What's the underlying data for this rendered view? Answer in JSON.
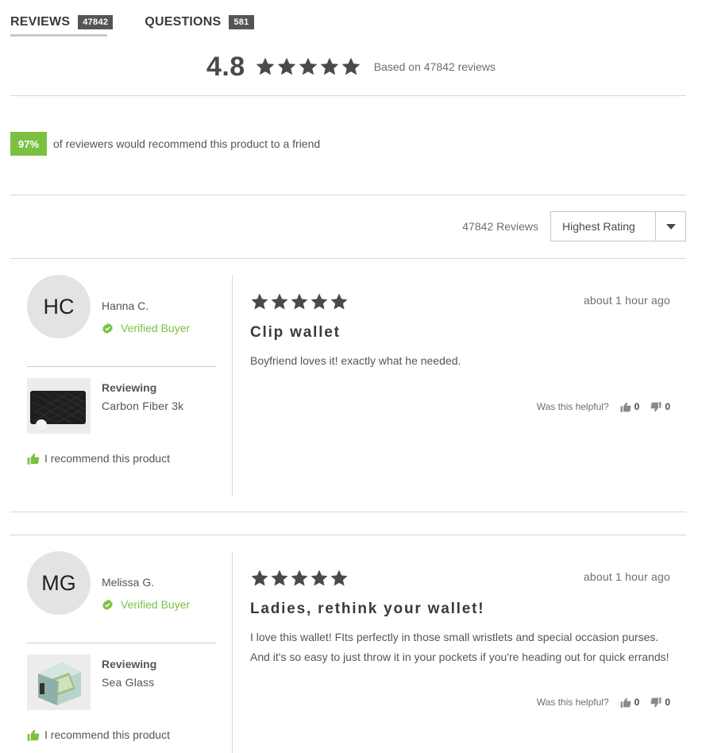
{
  "tabs": [
    {
      "label": "REVIEWS",
      "count": "47842"
    },
    {
      "label": "QUESTIONS",
      "count": "581"
    }
  ],
  "summary": {
    "average": "4.8",
    "stars": 5,
    "based_on": "Based on 47842 reviews"
  },
  "recommend": {
    "percent": "97%",
    "text": "of reviewers would recommend this product to a friend"
  },
  "sort": {
    "count_label": "47842 Reviews",
    "selected": "Highest Rating"
  },
  "colors": {
    "accent_green": "#7ac142",
    "star": "#4a4a4a",
    "badge_dark": "#555555"
  },
  "reviews": [
    {
      "initials": "HC",
      "name": "Hanna C.",
      "verified": "Verified Buyer",
      "reviewing_label": "Reviewing",
      "product": "Carbon Fiber 3k",
      "recommend_text": "I recommend this product",
      "rating": 5,
      "time": "about 1 hour ago",
      "title": "Clip wallet",
      "body": "Boyfriend loves it! exactly what he needed.",
      "helpful_label": "Was this helpful?",
      "up": "0",
      "down": "0"
    },
    {
      "initials": "MG",
      "name": "Melissa G.",
      "verified": "Verified Buyer",
      "reviewing_label": "Reviewing",
      "product": "Sea Glass",
      "recommend_text": "I recommend this product",
      "rating": 5,
      "time": "about 1 hour ago",
      "title": "Ladies, rethink your wallet!",
      "body": "I love this wallet! FIts perfectly in those small wristlets and special occasion purses. And it's so easy to just throw it in your pockets if you're heading out for quick errands!",
      "helpful_label": "Was this helpful?",
      "up": "0",
      "down": "0"
    }
  ]
}
